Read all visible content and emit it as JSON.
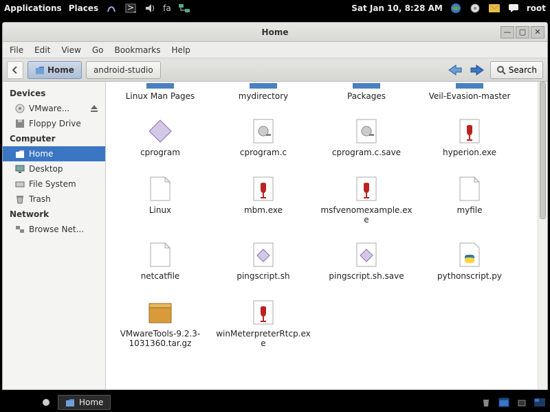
{
  "top_panel": {
    "apps": "Applications",
    "places": "Places",
    "fa": "fa",
    "clock": "Sat Jan 10,  8:28 AM",
    "user": "root"
  },
  "window": {
    "title": "Home",
    "menus": {
      "file": "File",
      "edit": "Edit",
      "view": "View",
      "go": "Go",
      "bookmarks": "Bookmarks",
      "help": "Help"
    },
    "crumb_home": "Home",
    "crumb_sub": "android-studio",
    "search": "Search"
  },
  "sidebar": {
    "devices": "Devices",
    "vmware": "VMware...",
    "floppy": "Floppy Drive",
    "computer": "Computer",
    "home": "Home",
    "desktop": "Desktop",
    "fs": "File System",
    "trash": "Trash",
    "network": "Network",
    "browse": "Browse Net..."
  },
  "files": {
    "f0": "Linux Man Pages",
    "f1": "mydirectory",
    "f2": "Packages",
    "f3": "Veil-Evasion-master",
    "f4": "cprogram",
    "f5": "cprogram.c",
    "f6": "cprogram.c.save",
    "f7": "hyperion.exe",
    "f8": "Linux",
    "f9": "mbm.exe",
    "f10": "msfvenomexample.exe",
    "f11": "myfile",
    "f12": "netcatfile",
    "f13": "pingscript.sh",
    "f14": "pingscript.sh.save",
    "f15": "pythonscript.py",
    "f16": "VMwareTools-9.2.3-1031360.tar.gz",
    "f17": "winMeterpreterRtcp.exe"
  },
  "taskbar": {
    "home": "Home"
  }
}
